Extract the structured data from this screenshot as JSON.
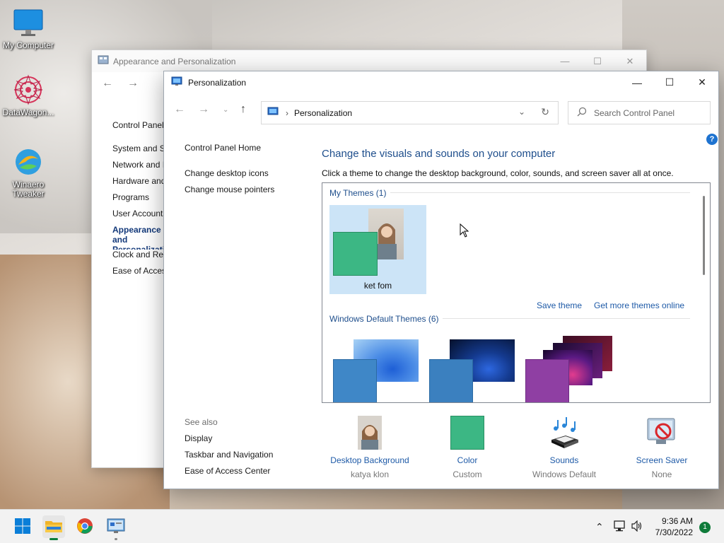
{
  "desktop": {
    "icons": [
      {
        "label": "My Computer"
      },
      {
        "label": "DataWagon..."
      },
      {
        "label": "Winaero Tweaker"
      }
    ]
  },
  "back_window": {
    "title": "Appearance and Personalization",
    "sidebar": [
      "Control Panel",
      "System and Se",
      "Network and I",
      "Hardware and",
      "Programs",
      "User Accounts",
      "Appearance and Personalization",
      "Clock and Reg",
      "Ease of Access"
    ]
  },
  "main_window": {
    "title": "Personalization",
    "address": {
      "crumb": "Personalization"
    },
    "search_placeholder": "Search Control Panel",
    "help_label": "?",
    "left_nav": {
      "home": "Control Panel Home",
      "desktop_icons": "Change desktop icons",
      "mouse_pointers": "Change mouse pointers"
    },
    "see_also": {
      "header": "See also",
      "items": [
        "Display",
        "Taskbar and Navigation",
        "Ease of Access Center"
      ]
    },
    "heading": "Change the visuals and sounds on your computer",
    "subheading": "Click a theme to change the desktop background, color, sounds, and screen saver all at once.",
    "my_themes": {
      "header": "My Themes (1)",
      "themes": [
        {
          "name": "ket fom",
          "accent": "#3cb784"
        }
      ]
    },
    "links": {
      "save": "Save theme",
      "more": "Get more themes online"
    },
    "default_themes": {
      "header": "Windows Default Themes (6)",
      "accents": [
        "#3f87c7",
        "#3b80bf",
        "#8f3fa3"
      ]
    },
    "bottom": [
      {
        "title": "Desktop Background",
        "sub": "katya klon"
      },
      {
        "title": "Color",
        "sub": "Custom",
        "swatch": "#3cb784"
      },
      {
        "title": "Sounds",
        "sub": "Windows Default"
      },
      {
        "title": "Screen Saver",
        "sub": "None"
      }
    ]
  },
  "taskbar": {
    "time": "9:36 AM",
    "date": "7/30/2022",
    "notifications": "1"
  }
}
